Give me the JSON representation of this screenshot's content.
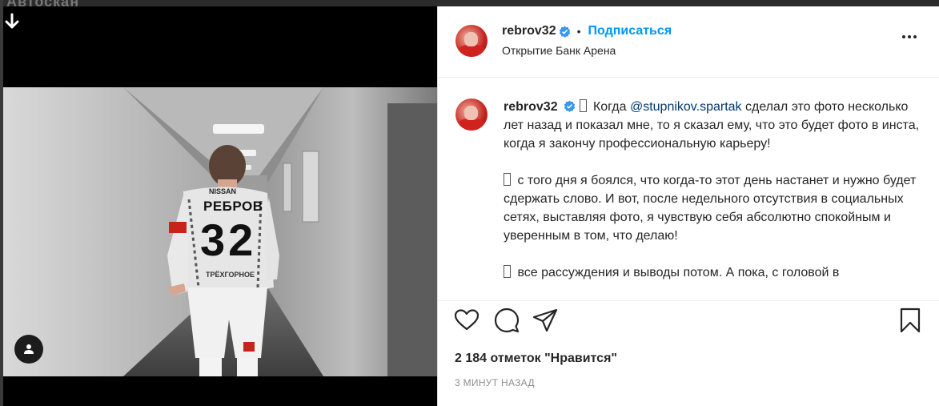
{
  "top_strip": {
    "ghost_text": "Автоскан"
  },
  "media": {
    "jersey_sponsor_top": "NISSAN",
    "jersey_name": "РЕБРОВ",
    "jersey_number": "32",
    "jersey_sponsor_bottom": "ТРЁХГОРНОЕ"
  },
  "post_header": {
    "username": "rebrov32",
    "dot": "•",
    "follow_label": "Подписаться",
    "location": "Открытие Банк Арена"
  },
  "caption": {
    "username": "rebrov32",
    "para1_before": " Когда ",
    "mention": "@stupnikov.spartak",
    "para1_after": " сделал это фото несколько лет назад и показал мне, то я сказал ему, что это будет фото в инста, когда я закончу профессиональную карьеру!",
    "para2": " с того дня я боялся, что когда-то этот день настанет и нужно будет сдержать слово. И вот, после недельного отсутствия в социальных сетях, выставляя фото, я чувствую себя абсолютно спокойным и уверенным в том, что делаю!",
    "para3": " все рассуждения и выводы потом. А пока, с головой в"
  },
  "likes_text": "2 184 отметок \"Нравится\"",
  "timestamp": "3 минут назад",
  "colors": {
    "accent": "#0095f6",
    "verified": "#3897f0",
    "text": "#262626",
    "muted": "#8e8e8e",
    "mention": "#00376b"
  },
  "icons": [
    "back-arrow-icon",
    "user-tag-icon",
    "verified-badge-icon",
    "more-options-icon",
    "heart-icon",
    "comment-icon",
    "share-icon",
    "bookmark-icon"
  ]
}
